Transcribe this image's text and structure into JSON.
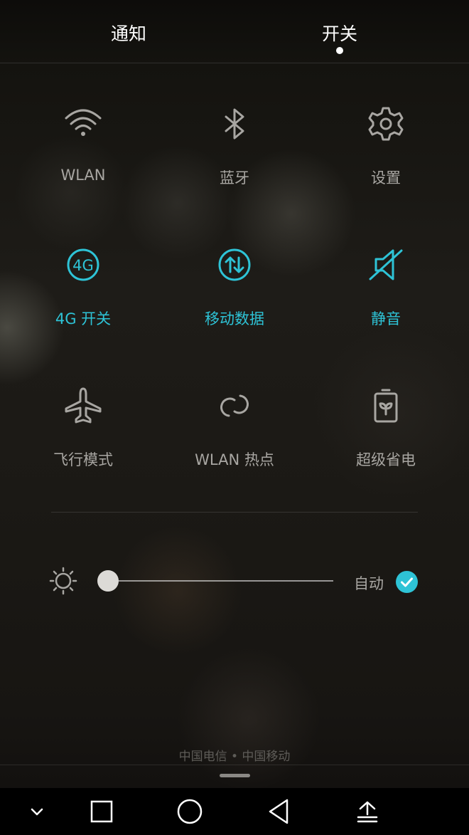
{
  "tabs": [
    {
      "label": "通知",
      "active": false
    },
    {
      "label": "开关",
      "active": true
    }
  ],
  "toggles": [
    {
      "label": "WLAN",
      "icon": "wifi-icon",
      "active": false
    },
    {
      "label": "蓝牙",
      "icon": "bluetooth-icon",
      "active": false
    },
    {
      "label": "设置",
      "icon": "gear-icon",
      "active": false
    },
    {
      "label": "4G 开关",
      "icon": "4g-icon",
      "active": true
    },
    {
      "label": "移动数据",
      "icon": "mobile-data-icon",
      "active": true
    },
    {
      "label": "静音",
      "icon": "mute-icon",
      "active": true
    },
    {
      "label": "飞行模式",
      "icon": "airplane-icon",
      "active": false
    },
    {
      "label": "WLAN 热点",
      "icon": "hotspot-icon",
      "active": false
    },
    {
      "label": "超级省电",
      "icon": "battery-saver-icon",
      "active": false
    }
  ],
  "brightness": {
    "level": 0.0,
    "auto_label": "自动",
    "auto_checked": true
  },
  "carrier": "中国电信 • 中国移动",
  "colors": {
    "accent": "#2ec3d6",
    "inactive": "#a8a6a2",
    "text": "#ffffff"
  },
  "navbar": {
    "buttons": [
      "chevron-down-icon",
      "recents-square-icon",
      "home-circle-icon",
      "back-triangle-icon",
      "upload-icon"
    ]
  }
}
